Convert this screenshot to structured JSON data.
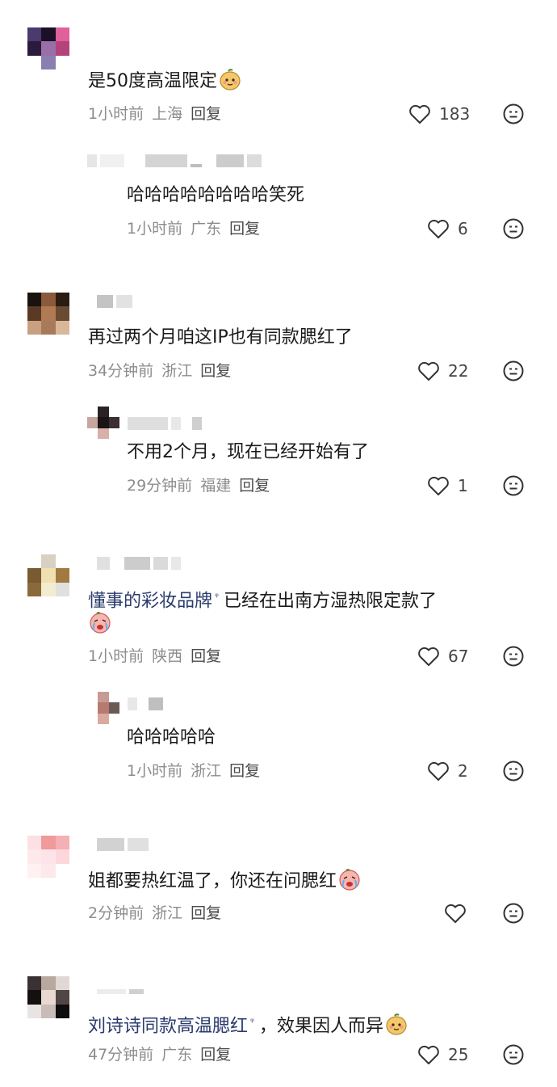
{
  "comments": [
    {
      "text": "是50度高温限定",
      "time": "1小时前",
      "region": "上海",
      "reply_label": "回复",
      "likes": "183",
      "replies": [
        {
          "text": "哈哈哈哈哈哈哈哈笑死",
          "time": "1小时前",
          "region": "广东",
          "reply_label": "回复",
          "likes": "6"
        }
      ]
    },
    {
      "text": "再过两个月咱这IP也有同款腮红了",
      "time": "34分钟前",
      "region": "浙江",
      "reply_label": "回复",
      "likes": "22",
      "replies": [
        {
          "text": "不用2个月，现在已经开始有了",
          "time": "29分钟前",
          "region": "福建",
          "reply_label": "回复",
          "likes": "1"
        }
      ]
    },
    {
      "link_text": "懂事的彩妆品牌",
      "text_after": "已经在出南方湿热限定款了",
      "time": "1小时前",
      "region": "陕西",
      "reply_label": "回复",
      "likes": "67",
      "replies": [
        {
          "text": "哈哈哈哈哈",
          "time": "1小时前",
          "region": "浙江",
          "reply_label": "回复",
          "likes": "2"
        }
      ]
    },
    {
      "text": "姐都要热红温了，你还在问腮红",
      "time": "2分钟前",
      "region": "浙江",
      "reply_label": "回复",
      "likes": ""
    },
    {
      "link_text": "刘诗诗同款高温腮红",
      "text_after": "，效果因人而异",
      "time": "47分钟前",
      "region": "广东",
      "reply_label": "回复",
      "likes": "25"
    }
  ],
  "icons": {
    "like": "heart-outline-icon",
    "dislike": "meh-face-icon",
    "search_suffix": "search-icon",
    "emoji_a": "pear-face-emoji",
    "emoji_b": "crying-face-emoji"
  },
  "colors": {
    "link": "#2a3b6d",
    "meta": "#8c8c8c",
    "text": "#1a1a1a"
  }
}
